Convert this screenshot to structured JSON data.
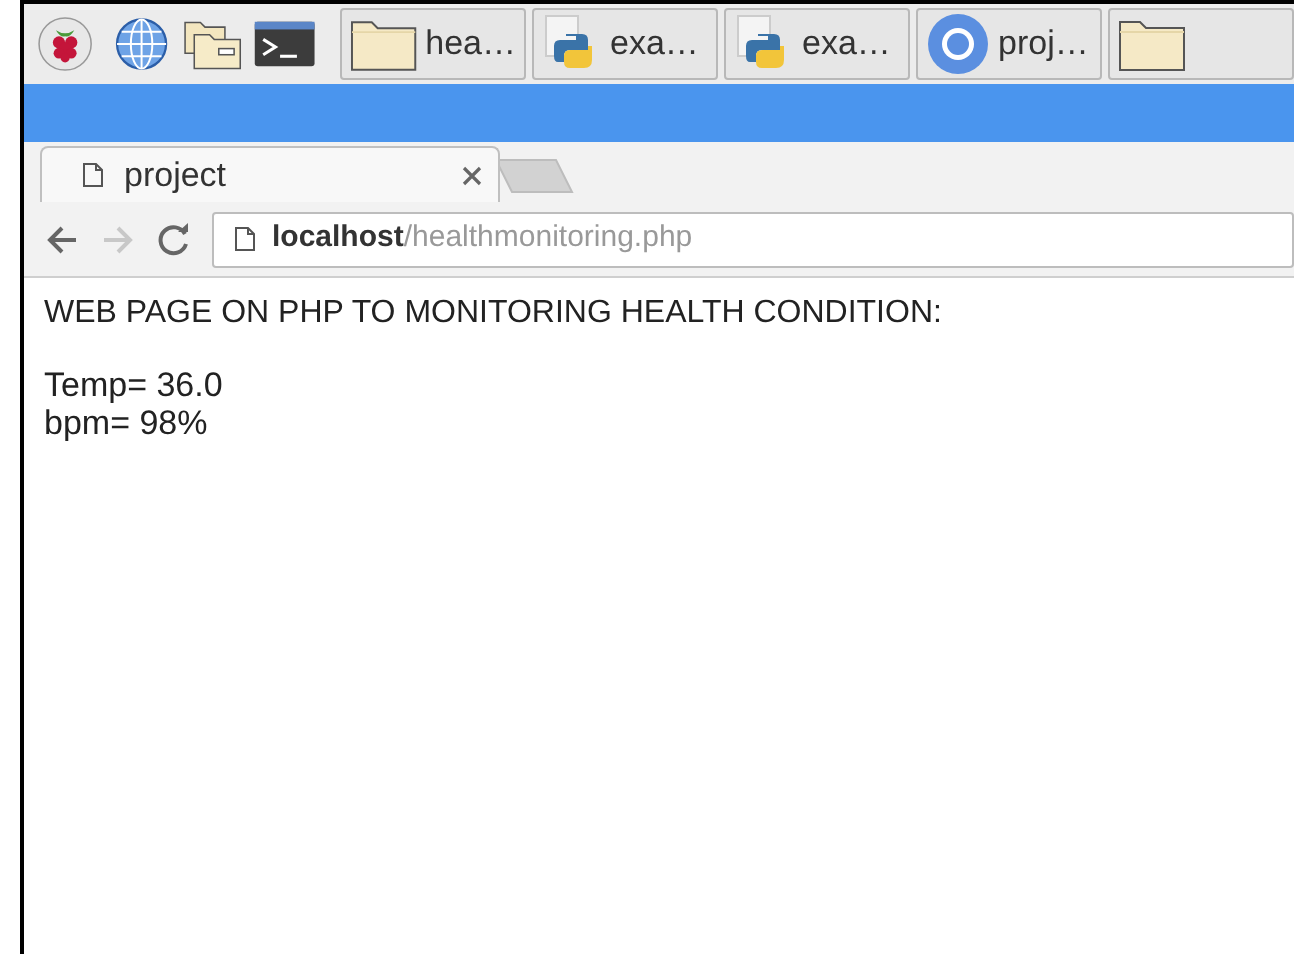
{
  "taskbar": {
    "tasks": [
      {
        "kind": "folder",
        "label": "hea…"
      },
      {
        "kind": "python",
        "label": "exa…"
      },
      {
        "kind": "python",
        "label": "exa…"
      },
      {
        "kind": "chrome",
        "label": "proj…"
      },
      {
        "kind": "folder"
      }
    ]
  },
  "browser": {
    "tabs": [
      {
        "title": "project",
        "selected": true
      }
    ],
    "address": {
      "host": "localhost",
      "path": "/healthmonitoring.php"
    }
  },
  "page": {
    "heading": "WEB PAGE ON PHP TO MONITORING HEALTH CONDITION:",
    "lines": [
      "Temp= 36.0",
      "bpm= 98%"
    ]
  }
}
